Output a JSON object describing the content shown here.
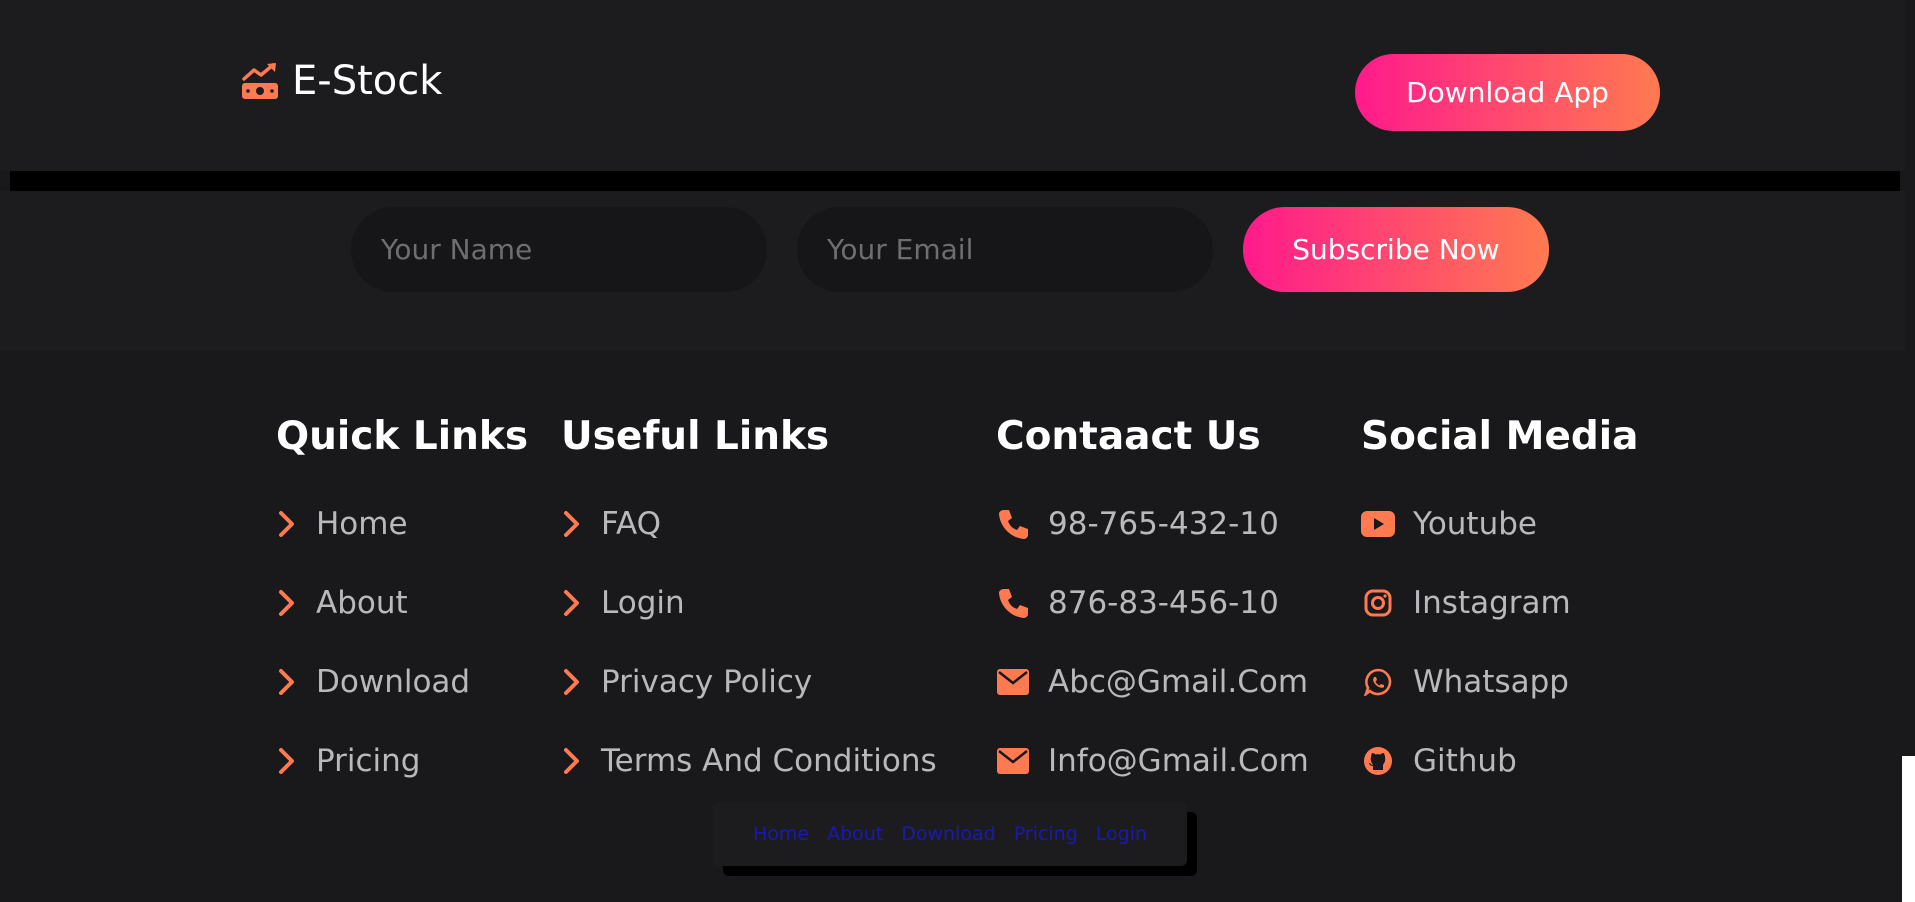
{
  "header": {
    "brand": "E-Stock",
    "download_label": "Download App"
  },
  "subscribe": {
    "name_placeholder": "Your Name",
    "email_placeholder": "Your Email",
    "button_label": "Subscribe Now"
  },
  "footer": {
    "quick_links": {
      "title": "Quick Links",
      "items": [
        "Home",
        "About",
        "Download",
        "Pricing"
      ]
    },
    "useful_links": {
      "title": "Useful Links",
      "items": [
        "FAQ",
        "Login",
        "Privacy Policy",
        "Terms And Conditions"
      ]
    },
    "contact": {
      "title": "Contaact Us",
      "items": [
        {
          "icon": "phone-icon",
          "text": "98-765-432-10"
        },
        {
          "icon": "phone-icon",
          "text": "876-83-456-10"
        },
        {
          "icon": "envelope-icon",
          "text": "Abc@Gmail.Com"
        },
        {
          "icon": "envelope-icon",
          "text": "Info@Gmail.Com"
        }
      ]
    },
    "social": {
      "title": "Social Media",
      "items": [
        {
          "icon": "youtube-icon",
          "text": "Youtube"
        },
        {
          "icon": "instagram-icon",
          "text": "Instagram"
        },
        {
          "icon": "whatsapp-icon",
          "text": "Whatsapp"
        },
        {
          "icon": "github-icon",
          "text": "Github"
        }
      ]
    }
  },
  "bottom_nav": [
    "Home",
    "About",
    "Download",
    "Pricing",
    "Login"
  ],
  "colors": {
    "accent": "#ff7a50",
    "gradient_start": "#ff1a8c",
    "gradient_end": "#ff7a50",
    "link_blue": "#1a1ab0"
  }
}
